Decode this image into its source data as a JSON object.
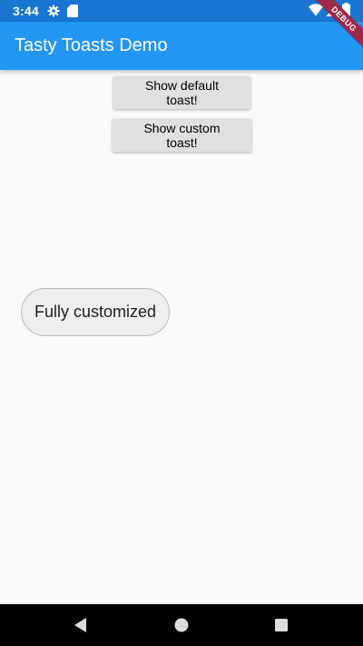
{
  "status_bar": {
    "time": "3:44",
    "icons": [
      "gear-icon",
      "sd-card-icon",
      "wifi-icon",
      "signal-icon",
      "battery-icon"
    ],
    "color": "#1976d2"
  },
  "debug_banner": {
    "label": "DEBUG",
    "color": "#a0284a"
  },
  "app_bar": {
    "title": "Tasty Toasts Demo",
    "color": "#2196f3"
  },
  "buttons": {
    "default_label": "Show default toast!",
    "custom_label": "Show custom toast!"
  },
  "toast": {
    "message": "Fully customized"
  },
  "nav_bar": {
    "icons": [
      "back-icon",
      "home-icon",
      "recents-icon"
    ]
  }
}
